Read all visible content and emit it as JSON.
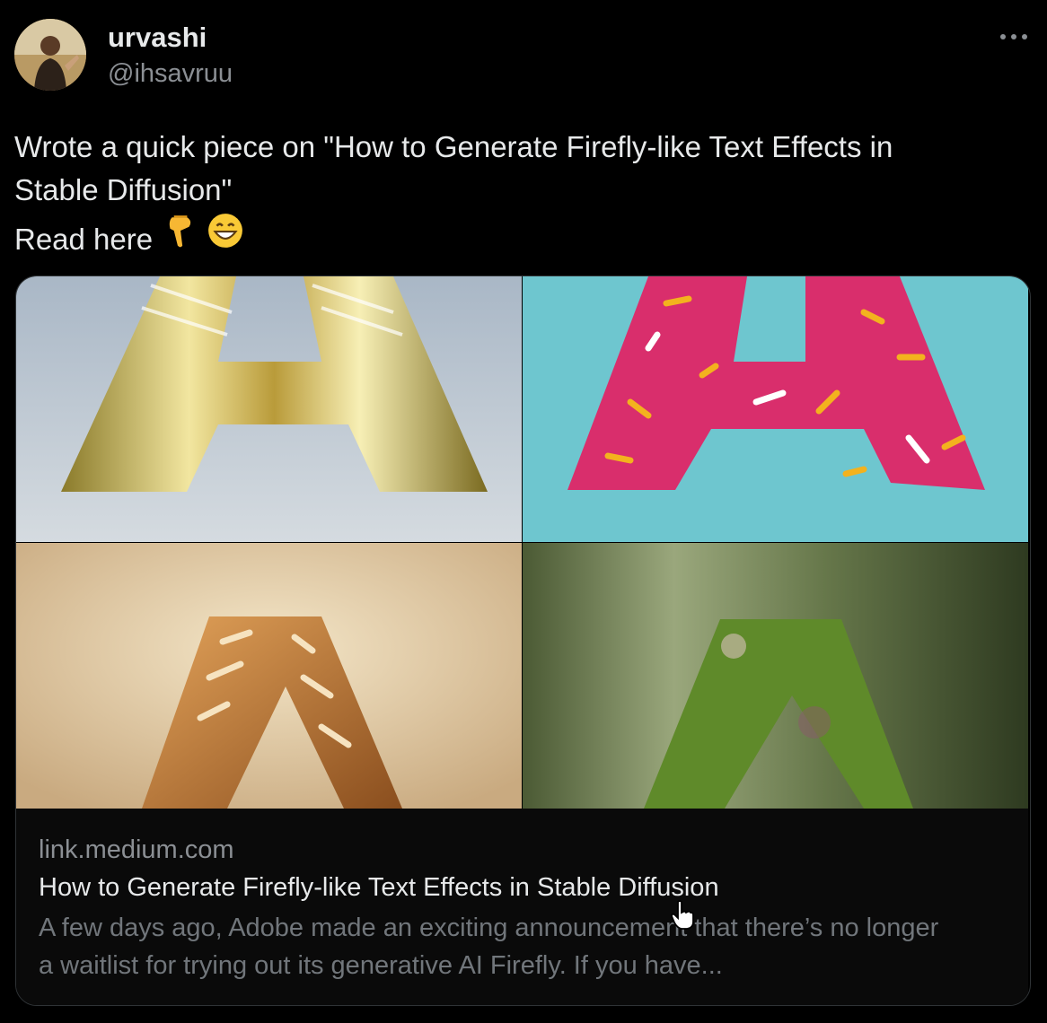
{
  "author": {
    "display_name": "urvashi",
    "handle": "@ihsavruu",
    "avatar_icon": "profile-photo-icon"
  },
  "menu": {
    "more_icon": "ellipsis-icon"
  },
  "tweet": {
    "line1": "Wrote a quick piece on \"How to Generate Firefly-like Text Effects in",
    "line2": "Stable Diffusion\"",
    "line3": "Read here",
    "emojis": [
      "backhand-index-pointing-down-icon",
      "grinning-face-icon"
    ]
  },
  "card": {
    "images": [
      {
        "name": "gold-balloon-letter-a",
        "colors": {
          "bg": "#b9c4cf",
          "letter": "#c9b45a"
        }
      },
      {
        "name": "pink-donut-letter-a",
        "colors": {
          "bg": "#6ec6cf",
          "letter": "#e0306f"
        }
      },
      {
        "name": "bread-letter-a",
        "colors": {
          "bg": "#e6d3b1",
          "letter": "#b5763a"
        }
      },
      {
        "name": "moss-letter-a",
        "colors": {
          "bg": "#4d5a35",
          "letter": "#5f8a2a"
        }
      }
    ],
    "domain": "link.medium.com",
    "title": "How to Generate Firefly-like Text Effects in Stable Diffusion",
    "description_line1": "A few days ago, Adobe made an exciting announcement that there’s no longer",
    "description_line2": "a waitlist for trying out its generative AI Firefly. If you have..."
  },
  "pointer": "hand-cursor-icon"
}
